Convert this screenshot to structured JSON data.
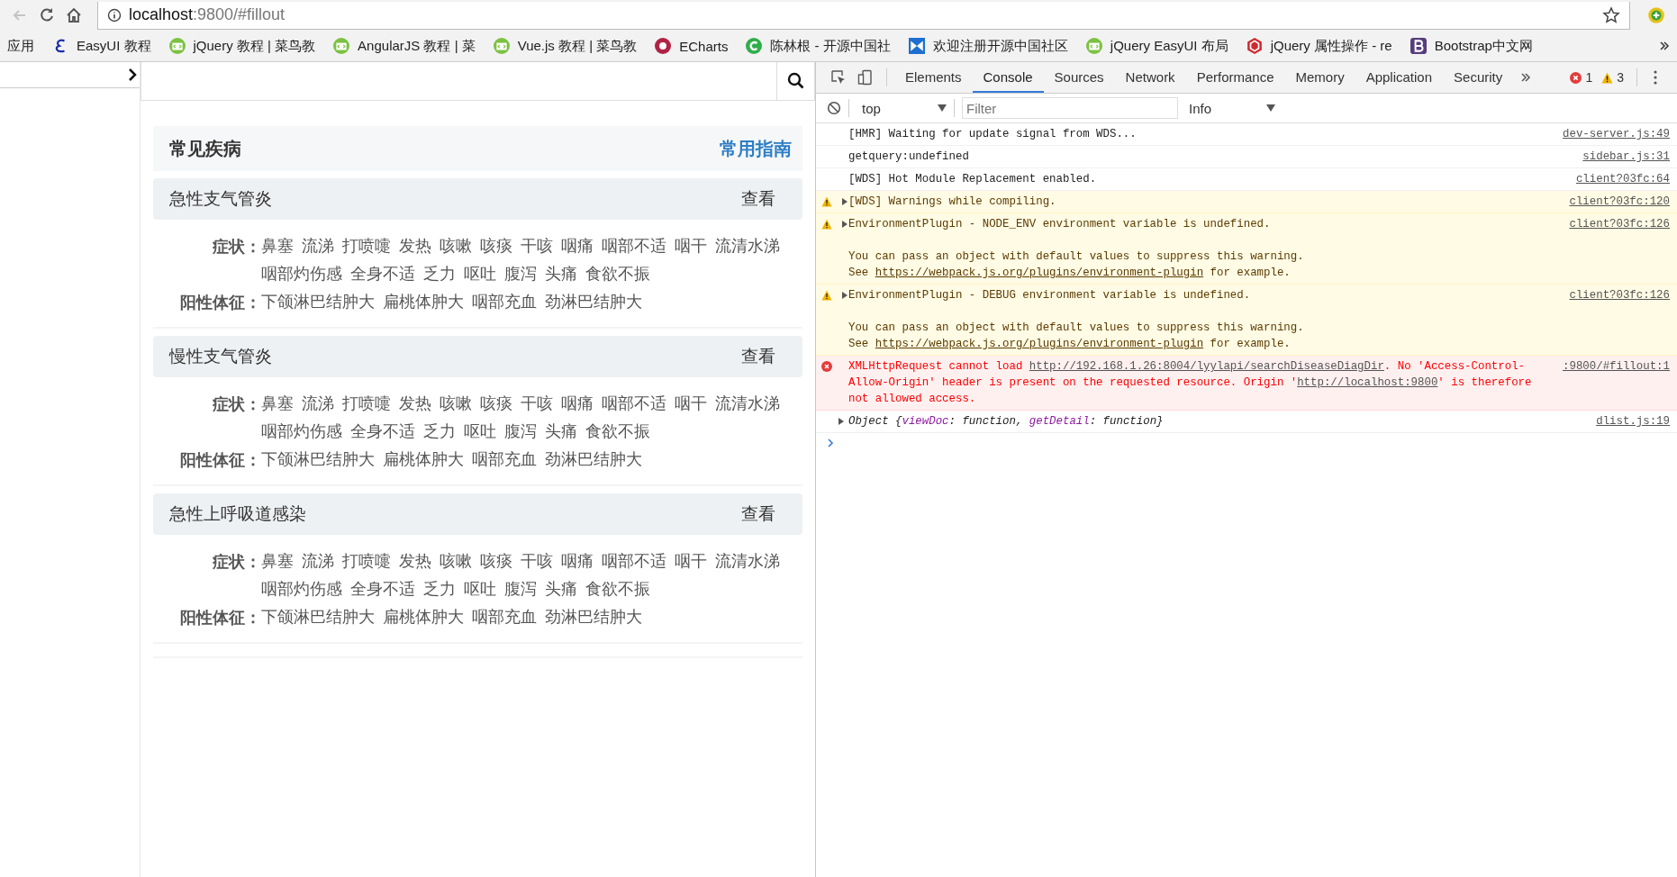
{
  "browser": {
    "back_disabled": true,
    "url_host": "localhost",
    "url_rest": ":9800/#fillout"
  },
  "bookmarks": [
    {
      "label": "应用",
      "kind": "none"
    },
    {
      "label": "EasyUI 教程",
      "kind": "letter-e"
    },
    {
      "label": "jQuery 教程 | 菜鸟教",
      "kind": "code-badge"
    },
    {
      "label": "AngularJS 教程 | 菜",
      "kind": "code-badge"
    },
    {
      "label": "Vue.js 教程 | 菜鸟教",
      "kind": "code-badge"
    },
    {
      "label": "ECharts",
      "kind": "ring"
    },
    {
      "label": "陈林根 - 开源中国社",
      "kind": "c-circle"
    },
    {
      "label": "欢迎注册开源中国社区",
      "kind": "ribbon"
    },
    {
      "label": "jQuery EasyUI 布局",
      "kind": "code-badge"
    },
    {
      "label": "jQuery 属性操作 - re",
      "kind": "cube"
    },
    {
      "label": "Bootstrap中文网",
      "kind": "b-square"
    }
  ],
  "page": {
    "header": {
      "title": "常见疾病",
      "link": "常用指南"
    },
    "diseases": [
      {
        "name": "急性支气管炎",
        "action": "查看",
        "symptoms_label": "症状：",
        "symptoms": [
          "鼻塞",
          "流涕",
          "打喷嚏",
          "发热",
          "咳嗽",
          "咳痰",
          "干咳",
          "咽痛",
          "咽部不适",
          "咽干",
          "流清水涕",
          "咽部灼伤感",
          "全身不适",
          "乏力",
          "呕吐",
          "腹泻",
          "头痛",
          "食欲不振"
        ],
        "signs_label": "阳性体征：",
        "signs": [
          "下颌淋巴结肿大",
          "扁桃体肿大",
          "咽部充血",
          "劲淋巴结肿大"
        ]
      },
      {
        "name": "慢性支气管炎",
        "action": "查看",
        "symptoms_label": "症状：",
        "symptoms": [
          "鼻塞",
          "流涕",
          "打喷嚏",
          "发热",
          "咳嗽",
          "咳痰",
          "干咳",
          "咽痛",
          "咽部不适",
          "咽干",
          "流清水涕",
          "咽部灼伤感",
          "全身不适",
          "乏力",
          "呕吐",
          "腹泻",
          "头痛",
          "食欲不振"
        ],
        "signs_label": "阳性体征：",
        "signs": [
          "下颌淋巴结肿大",
          "扁桃体肿大",
          "咽部充血",
          "劲淋巴结肿大"
        ]
      },
      {
        "name": "急性上呼吸道感染",
        "action": "查看",
        "symptoms_label": "症状：",
        "symptoms": [
          "鼻塞",
          "流涕",
          "打喷嚏",
          "发热",
          "咳嗽",
          "咳痰",
          "干咳",
          "咽痛",
          "咽部不适",
          "咽干",
          "流清水涕",
          "咽部灼伤感",
          "全身不适",
          "乏力",
          "呕吐",
          "腹泻",
          "头痛",
          "食欲不振"
        ],
        "signs_label": "阳性体征：",
        "signs": [
          "下颌淋巴结肿大",
          "扁桃体肿大",
          "咽部充血",
          "劲淋巴结肿大"
        ]
      }
    ]
  },
  "devtools": {
    "tabs": [
      {
        "label": "Elements",
        "selected": false
      },
      {
        "label": "Console",
        "selected": true
      },
      {
        "label": "Sources",
        "selected": false
      },
      {
        "label": "Network",
        "selected": false
      },
      {
        "label": "Performance",
        "selected": false
      },
      {
        "label": "Memory",
        "selected": false
      },
      {
        "label": "Application",
        "selected": false
      },
      {
        "label": "Security",
        "selected": false
      }
    ],
    "error_count": "1",
    "warning_count": "3",
    "context": "top",
    "filter_placeholder": "Filter",
    "level": "Info",
    "messages": [
      {
        "kind": "log",
        "lines": [
          [
            {
              "kind": "text",
              "text": "[HMR] Waiting for update signal from WDS..."
            }
          ]
        ],
        "source": "dev-server.js:49"
      },
      {
        "kind": "log",
        "lines": [
          [
            {
              "kind": "text",
              "text": "getquery:undefined"
            }
          ]
        ],
        "source": "sidebar.js:31"
      },
      {
        "kind": "log",
        "lines": [
          [
            {
              "kind": "text",
              "text": "[WDS] Hot Module Replacement enabled."
            }
          ]
        ],
        "source": "client?03fc:64"
      },
      {
        "kind": "warning",
        "expanded": false,
        "lines": [
          [
            {
              "kind": "text",
              "text": "[WDS] Warnings while compiling."
            }
          ]
        ],
        "source": "client?03fc:120"
      },
      {
        "kind": "warning",
        "expanded": false,
        "lines": [
          [
            {
              "kind": "text",
              "text": "EnvironmentPlugin - NODE_ENV environment variable is undefined."
            }
          ]
        ],
        "details": [
          [
            {
              "kind": "text",
              "text": "You can pass an object with default values to suppress this warning."
            }
          ],
          [
            {
              "kind": "text",
              "text": "See "
            },
            {
              "kind": "link",
              "text": "https://webpack.js.org/plugins/environment-plugin"
            },
            {
              "kind": "text",
              "text": " for example."
            }
          ]
        ],
        "source": "client?03fc:126"
      },
      {
        "kind": "warning",
        "expanded": false,
        "lines": [
          [
            {
              "kind": "text",
              "text": "EnvironmentPlugin - DEBUG environment variable is undefined."
            }
          ]
        ],
        "details": [
          [
            {
              "kind": "text",
              "text": "You can pass an object with default values to suppress this warning."
            }
          ],
          [
            {
              "kind": "text",
              "text": "See "
            },
            {
              "kind": "link",
              "text": "https://webpack.js.org/plugins/environment-plugin"
            },
            {
              "kind": "text",
              "text": " for example."
            }
          ]
        ],
        "source": "client?03fc:126"
      },
      {
        "kind": "error",
        "lines": [
          [
            {
              "kind": "text",
              "text": "XMLHttpRequest cannot load "
            },
            {
              "kind": "link",
              "text": "http://192.168.1.26:8004/lyylapi/searchDiseaseDiagDir"
            },
            {
              "kind": "text",
              "text": ". No 'Access-Control-Allow-Origin' header is present on the requested resource. Origin '"
            },
            {
              "kind": "link",
              "text": "http://localhost:9800"
            },
            {
              "kind": "text",
              "text": "' is therefore not allowed access."
            }
          ]
        ],
        "source": ":9800/#fillout:1"
      },
      {
        "kind": "object",
        "expanded": false,
        "lines": [
          [
            {
              "kind": "text",
              "text": "Object {"
            },
            {
              "kind": "key",
              "text": "viewDoc"
            },
            {
              "kind": "text",
              "text": ": function, "
            },
            {
              "kind": "key",
              "text": "getDetail"
            },
            {
              "kind": "text",
              "text": ": function}"
            }
          ]
        ],
        "source": "dlist.js:19"
      }
    ]
  }
}
